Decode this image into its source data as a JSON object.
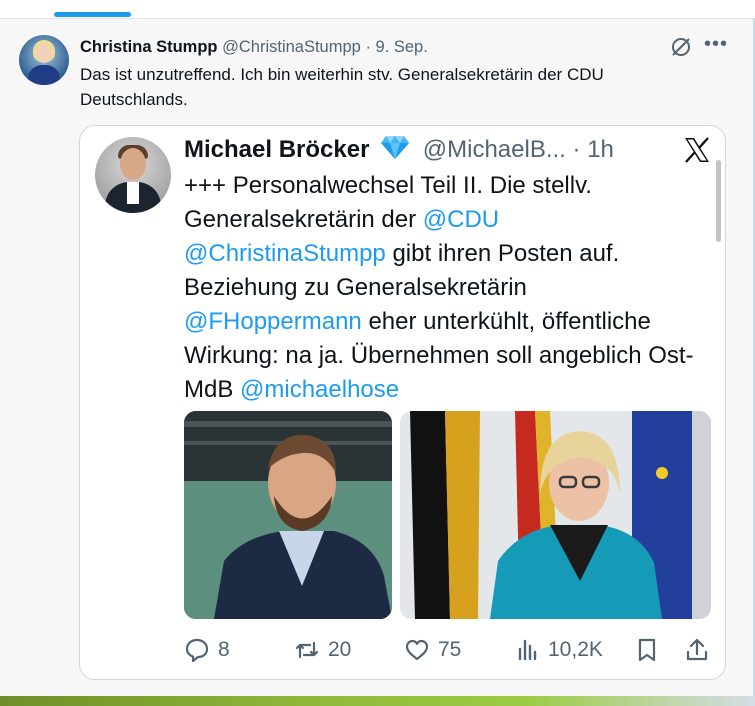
{
  "post": {
    "author_name": "Christina Stumpp",
    "author_handle": "@ChristinaStumpp",
    "separator": "·",
    "date": "9. Sep.",
    "text": "Das ist unzutreffend. Ich bin weiterhin stv. Generalsekretärin der CDU Deutschlands."
  },
  "quoted": {
    "author_name": "Michael Bröcker",
    "author_handle": "@MichaelB...",
    "separator": "·",
    "time": "1h",
    "text_parts": [
      "+++ Personalwechsel Teil II. Die stellv. Generalsekretärin der ",
      "@CDU",
      " ",
      "@ChristinaStumpp",
      " gibt ihren Posten auf. Beziehung zu Generalsekretärin ",
      "@FHoppermann",
      " eher unterkühlt, öffentliche Wirkung: na ja. Übernehmen soll angeblich Ost-MdB ",
      "@michaelhose"
    ],
    "actions": {
      "replies": "8",
      "reposts": "20",
      "likes": "75",
      "views": "10,2K"
    }
  },
  "colors": {
    "accent": "#1d9bf0",
    "text": "#0f1419",
    "muted": "#536471"
  },
  "icons": [
    "grok-icon",
    "more-icon",
    "verified-icon",
    "x-logo-icon",
    "reply-icon",
    "repost-icon",
    "like-icon",
    "views-icon",
    "bookmark-icon",
    "share-icon"
  ]
}
